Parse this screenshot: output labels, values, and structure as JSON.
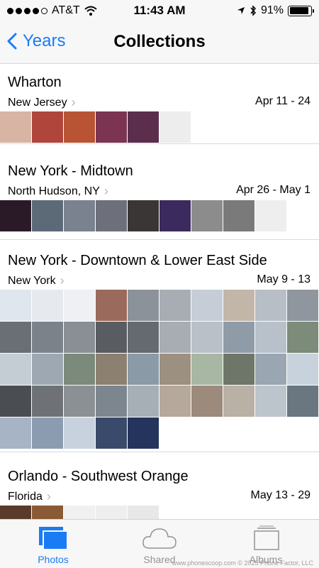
{
  "status_bar": {
    "carrier": "AT&T",
    "time": "11:43 AM",
    "battery": "91%",
    "battery_level": 0.91
  },
  "nav": {
    "back_label": "Years",
    "title": "Collections"
  },
  "collections": [
    {
      "title": "Wharton",
      "subtitle": "New Jersey",
      "date": "Apr 11 - 24",
      "colors": [
        "#d8b4a4",
        "#b0453c",
        "#b85434",
        "#7b3552",
        "#5c2e4d",
        "#ededed"
      ]
    },
    {
      "title": "New York - Midtown",
      "subtitle": "North Hudson, NY",
      "date": "Apr 26 - May 1",
      "colors": [
        "#2a1a28",
        "#5c6a78",
        "#7a8290",
        "#6d707a",
        "#3a3636",
        "#3a2a5e",
        "#8c8c8c",
        "#7a7a7a",
        "#eeeeee"
      ]
    },
    {
      "title": "New York - Downtown & Lower East Side",
      "subtitle": "New York",
      "date": "May 9 - 13",
      "colors": [
        "#dfe6ee",
        "#e6e9ee",
        "#eef0f3",
        "#9a6a5c",
        "#8c929a",
        "#a8adb4",
        "#c6cdd6",
        "#c1b6a8",
        "#b8bec6",
        "#8f969e",
        "#6a6f76",
        "#7b828a",
        "#8a8f95",
        "#595d62",
        "#646a70",
        "#a8adb4",
        "#b9c0c8",
        "#8f9ba6",
        "#b8c1ca",
        "#7d8b7a",
        "#c4ccd4",
        "#9ea8b2",
        "#7c8a7c",
        "#8c8070",
        "#8a9aa6",
        "#9c9080",
        "#a8b6a4",
        "#6e766a",
        "#9aa6b2",
        "#c8d2dc",
        "#4a4e52",
        "#6e7276",
        "#8a9094",
        "#7d868e",
        "#a6aeb6",
        "#b6a89a",
        "#9c8a7c",
        "#b9b0a6",
        "#bcc4cc",
        "#6a7680",
        "#a6b4c6",
        "#8c9cb0",
        "#c8d2de",
        "#3a4a6a",
        "#24345c"
      ]
    },
    {
      "title": "Orlando - Southwest Orange",
      "subtitle": "Florida",
      "date": "May 13 - 29",
      "colors": [
        "#5a3a2a",
        "#8a5a34",
        "#f0f0f0",
        "#eeeeee",
        "#e8e8e8"
      ]
    }
  ],
  "tabs": [
    {
      "label": "Photos",
      "icon": "photos-icon",
      "active": true
    },
    {
      "label": "Shared",
      "icon": "cloud-icon",
      "active": false
    },
    {
      "label": "Albums",
      "icon": "albums-icon",
      "active": false
    }
  ],
  "watermark": "www.phonescoop.com © 2025 Phone Factor, LLC"
}
